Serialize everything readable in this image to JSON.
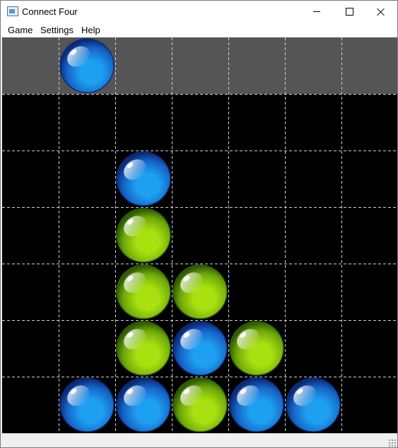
{
  "window": {
    "title": "Connect Four",
    "icon": "app-window-icon",
    "controls": [
      "minimize-icon",
      "maximize-icon",
      "close-icon"
    ]
  },
  "menu": {
    "game": "Game",
    "settings": "Settings",
    "help": "Help"
  },
  "board": {
    "columns": 7,
    "rows": 6,
    "colors": {
      "background": "#000000",
      "drop_row": "#555555",
      "gridline": "#cfcfcf",
      "blue_piece": "#1ea0f0",
      "green_piece": "#a8e010"
    },
    "hover_piece": {
      "color": "blue",
      "column": 2
    },
    "cells": [
      [
        "",
        "",
        "",
        "",
        "",
        "",
        ""
      ],
      [
        "",
        "",
        "blue",
        "",
        "",
        "",
        ""
      ],
      [
        "",
        "",
        "green",
        "",
        "",
        "",
        ""
      ],
      [
        "",
        "",
        "green",
        "green",
        "",
        "",
        ""
      ],
      [
        "",
        "",
        "green",
        "blue",
        "green",
        "",
        ""
      ],
      [
        "",
        "blue",
        "blue",
        "green",
        "blue",
        "blue",
        ""
      ]
    ]
  }
}
